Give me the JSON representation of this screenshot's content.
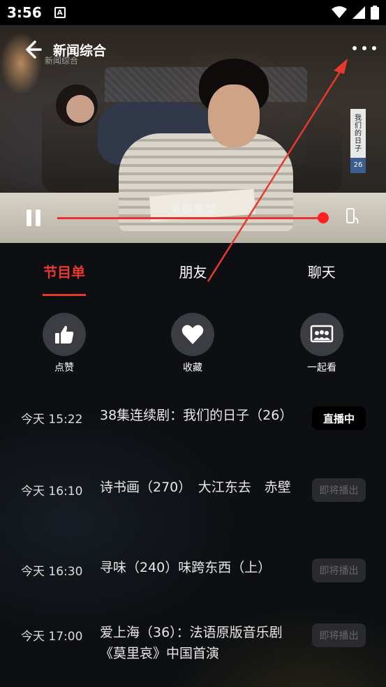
{
  "status_bar": {
    "time": "3:56",
    "notif_icon": "A"
  },
  "player": {
    "channel_title": "新闻综合",
    "watermark": "新闻综合",
    "subtitle": "全是素菜",
    "poster_text": "我们的日子",
    "poster_number": "26",
    "progress": 1.0,
    "accent_color": "#e8322e"
  },
  "tabs": [
    {
      "label": "节目单",
      "active": true
    },
    {
      "label": "朋友",
      "active": false
    },
    {
      "label": "聊天",
      "active": false
    }
  ],
  "actions": [
    {
      "label": "点赞",
      "icon": "thumbs-up-icon"
    },
    {
      "label": "收藏",
      "icon": "heart-icon"
    },
    {
      "label": "一起看",
      "icon": "watch-together-icon"
    }
  ],
  "schedule": [
    {
      "time": "今天 15:22",
      "title": "38集连续剧：我们的日子（26）",
      "status": "直播中"
    },
    {
      "time": "今天 16:10",
      "title": "诗书画（270）　大江东去　赤壁",
      "status": "即将播出"
    },
    {
      "time": "今天 16:30",
      "title": "寻味（240）味跨东西（上）",
      "status": "即将播出"
    },
    {
      "time": "今天 17:00",
      "title": "爱上海（36）：法语原版音乐剧《莫里哀》中国首演",
      "status": "即将播出"
    }
  ]
}
